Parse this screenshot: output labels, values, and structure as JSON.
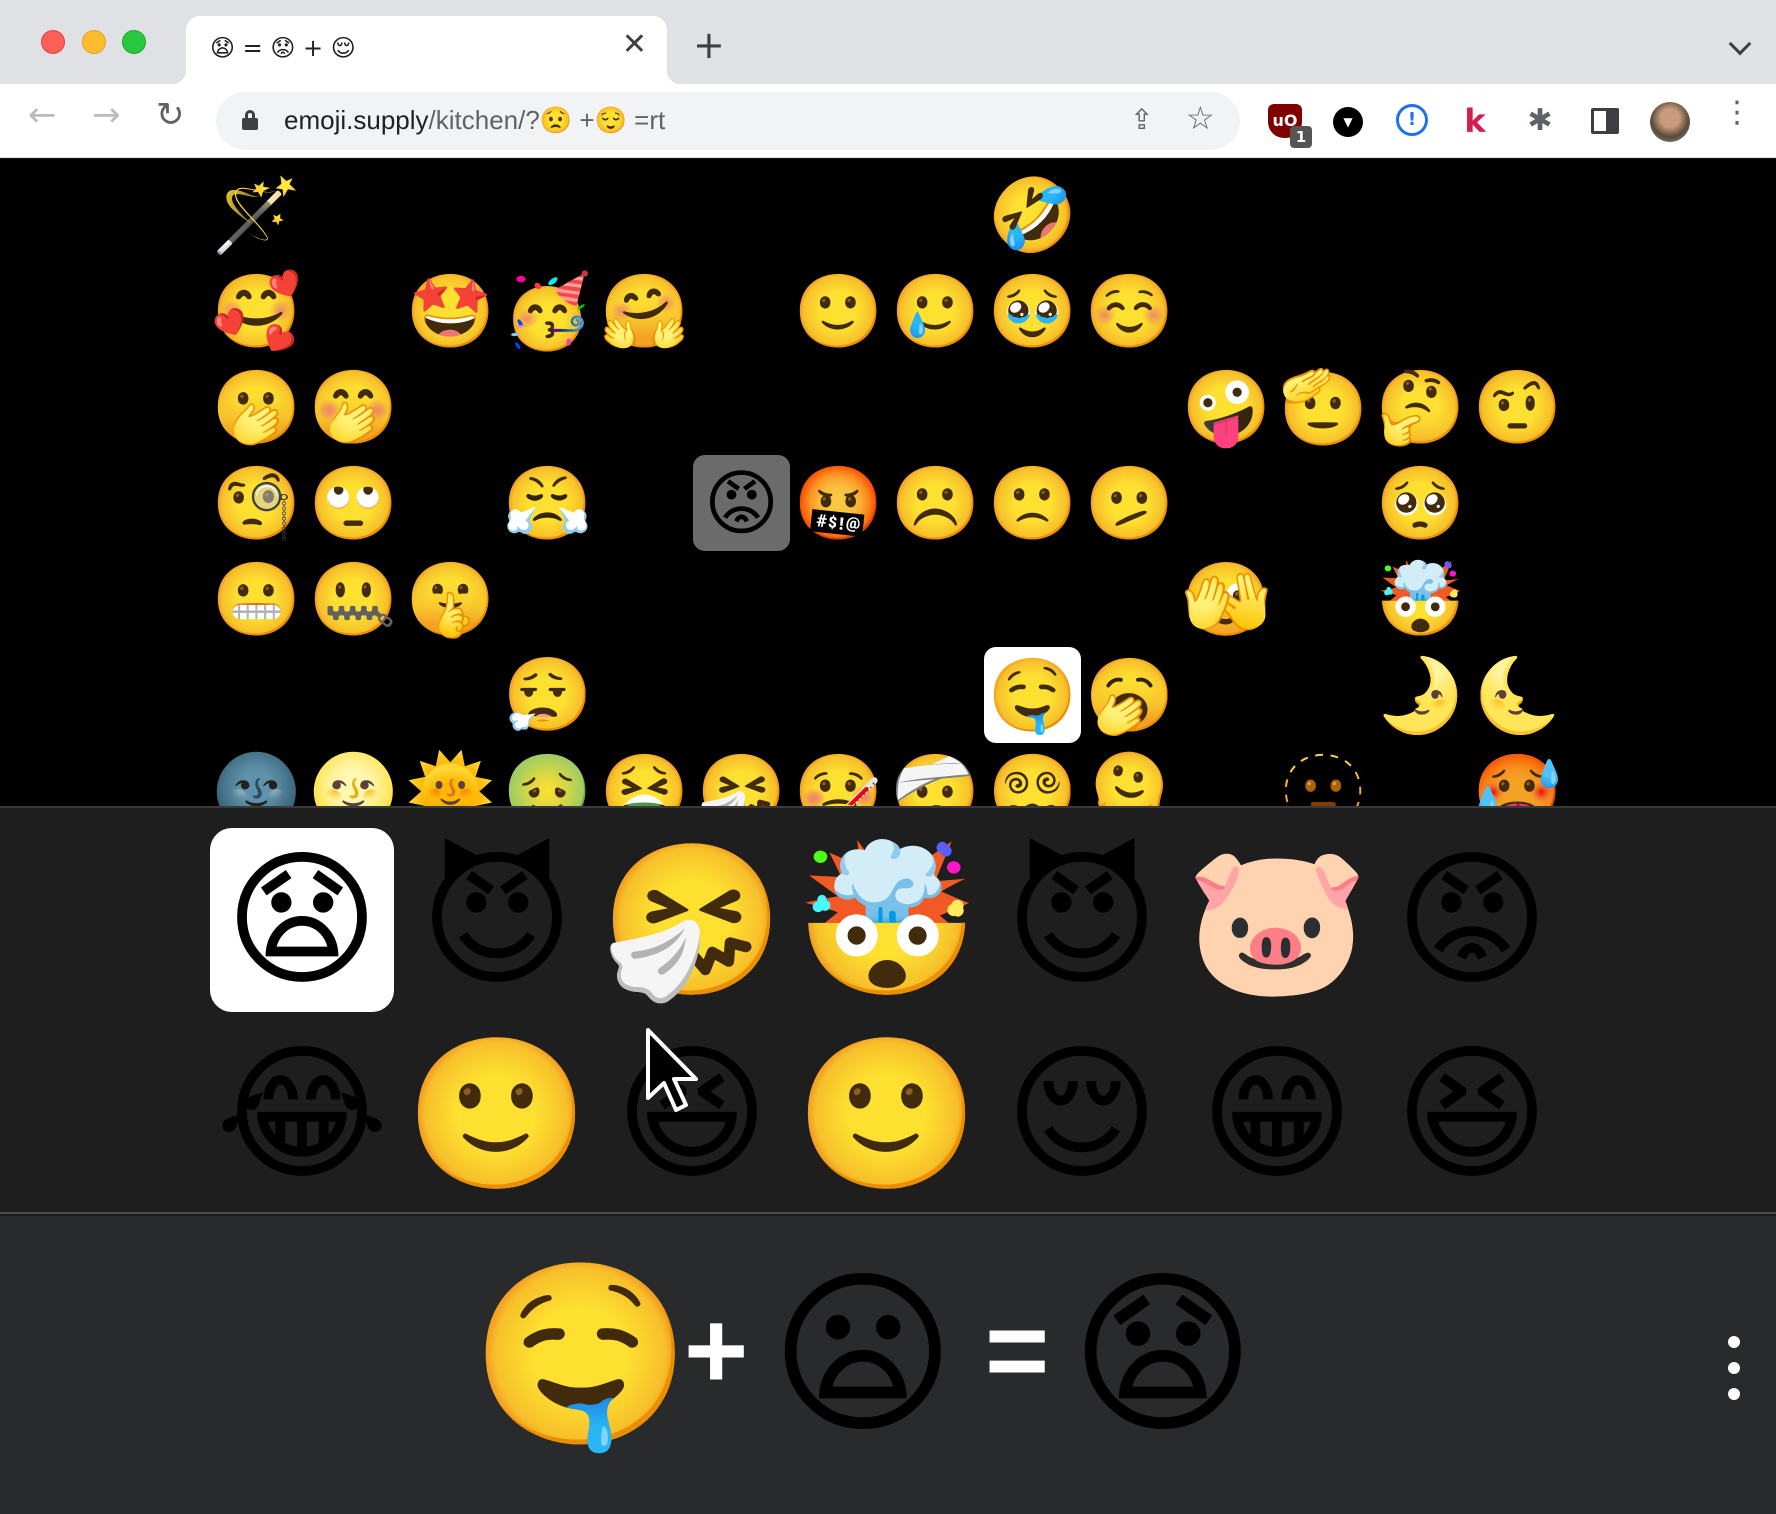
{
  "browser": {
    "tab_title": "😧 = 😟 + 😌",
    "tab_close": "✕",
    "new_tab": "+",
    "url_domain": "emoji.supply",
    "url_path": "/kitchen/?😟 +😌 =rt",
    "back": "←",
    "forward": "→",
    "reload": "↻",
    "share": "⇪",
    "star": "☆",
    "ublock_label": "uO",
    "ublock_badge": "1",
    "onepass_label": "!",
    "k_label": "k",
    "puzzle": "✱",
    "menu": "⋮"
  },
  "picker": {
    "rows": [
      [
        "🪄",
        "😀",
        "😃",
        "😄",
        "😁",
        "😆",
        "😅",
        "😂",
        "🤣",
        "😭",
        "😗",
        "😙",
        "😚",
        "😘"
      ],
      [
        "🥰",
        "😍",
        "🤩",
        "🥳",
        "🤗",
        "🙃",
        "🙂",
        "🥲",
        "🥹",
        "☺️",
        "😊",
        "😏",
        "😌",
        "😉"
      ],
      [
        "🫢",
        "🤭",
        "😶",
        "😐",
        "😑",
        "😔",
        "😋",
        "😛",
        "😝",
        "😜",
        "🤪",
        "🫡",
        "🤔",
        "🤨"
      ],
      [
        "🧐",
        "🙄",
        "😒",
        "😤",
        "😠",
        "😡",
        "🤬",
        "☹️",
        "🙁",
        "🫤",
        "😕",
        "😟",
        "🥺",
        "😳"
      ],
      [
        "😬",
        "🤐",
        "🤫",
        "😰",
        "😨",
        "😧",
        "😦",
        "😮",
        "😯",
        "😲",
        "🫣",
        "😱",
        "🤯",
        "😢"
      ],
      [
        "😥",
        "😓",
        "😞",
        "😮‍💨",
        "😖",
        "😣",
        "😩",
        "😫",
        "🤤",
        "🥱",
        "😴",
        "😪",
        "🌛",
        "🌜"
      ],
      [
        "🌚",
        "🌝",
        "🌞",
        "🤢",
        "🤮",
        "🤧",
        "🤒",
        "🤕",
        "😵‍💫",
        "🫠",
        "😇",
        "🫥",
        "😵",
        "🥵"
      ]
    ],
    "selected_grey": "4.5",
    "selected_white": "5.8"
  },
  "combos": {
    "items": [
      "😧",
      "😈",
      "🤧",
      "🤯",
      "😈",
      "🐷",
      "😡",
      "😂",
      "🙂",
      "😆",
      "🙂",
      "😌",
      "😁",
      "😆"
    ],
    "selected_index": 0
  },
  "result": {
    "left": "🤤",
    "plus": "+",
    "right": "😦",
    "equals": "=",
    "output": "😧"
  },
  "colors": {
    "picker_bg": "#000000",
    "combos_bg": "#1e1e1e",
    "result_bg": "#282a2c",
    "selected_grey": "#6b6b6b",
    "selected_white": "#ffffff"
  }
}
